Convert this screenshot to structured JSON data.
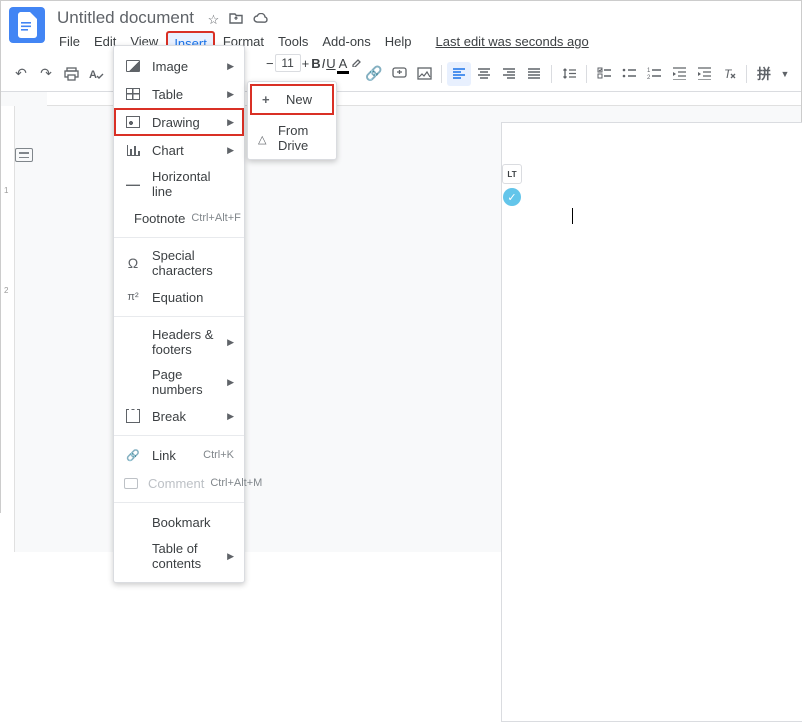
{
  "doc": {
    "title": "Untitled document"
  },
  "menubar": {
    "file": "File",
    "edit": "Edit",
    "view": "View",
    "insert": "Insert",
    "format": "Format",
    "tools": "Tools",
    "addons": "Add-ons",
    "help": "Help",
    "last_edit": "Last edit was seconds ago"
  },
  "toolbar": {
    "font_size": "11",
    "align_left_active": true
  },
  "insert_menu": {
    "image": "Image",
    "table": "Table",
    "drawing": "Drawing",
    "chart": "Chart",
    "horizontal_line": "Horizontal line",
    "footnote": "Footnote",
    "footnote_shortcut": "Ctrl+Alt+F",
    "special_characters": "Special characters",
    "equation": "Equation",
    "headers_footers": "Headers & footers",
    "page_numbers": "Page numbers",
    "break": "Break",
    "link": "Link",
    "link_shortcut": "Ctrl+K",
    "comment": "Comment",
    "comment_shortcut": "Ctrl+Alt+M",
    "bookmark": "Bookmark",
    "table_of_contents": "Table of contents"
  },
  "drawing_submenu": {
    "new": "New",
    "from_drive": "From Drive"
  },
  "ext": {
    "lt": "LT"
  },
  "vruler": {
    "one": "1",
    "two": "2"
  }
}
